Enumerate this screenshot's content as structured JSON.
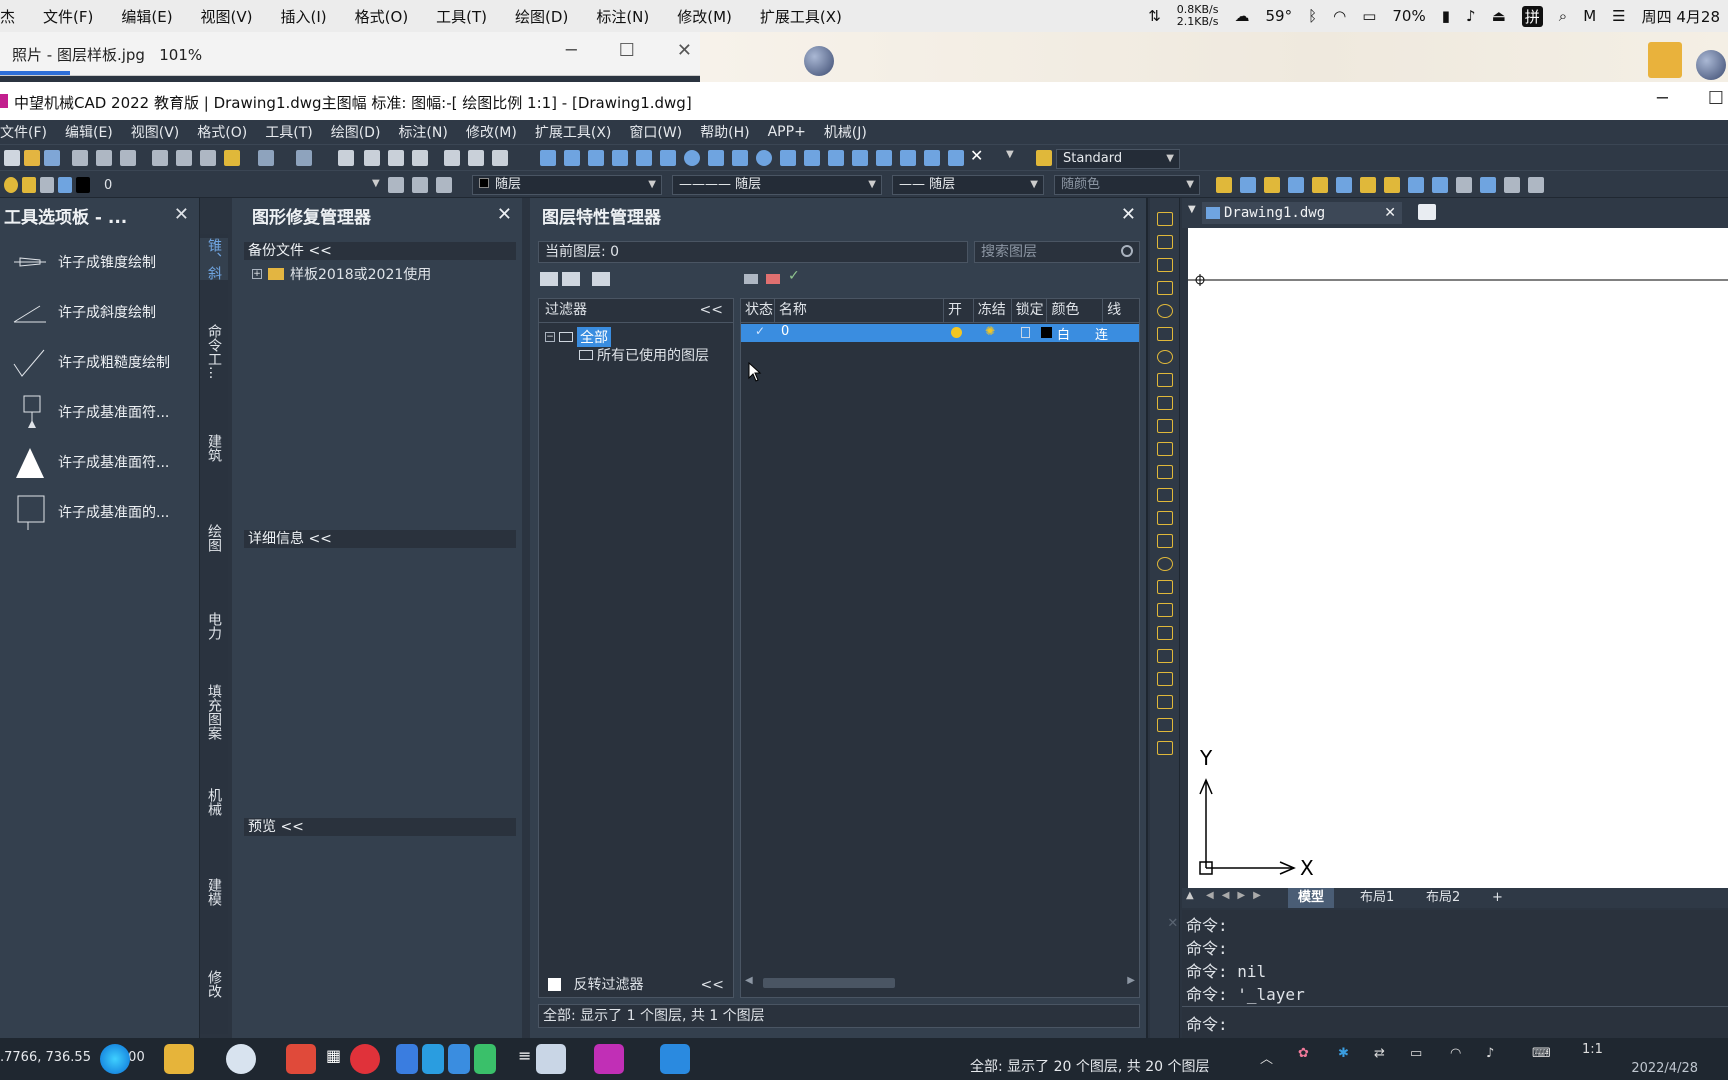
{
  "mac_menubar": {
    "app": "杰",
    "items": [
      "文件(F)",
      "编辑(E)",
      "视图(V)",
      "插入(I)",
      "格式(O)",
      "工具(T)",
      "绘图(D)",
      "标注(N)",
      "修改(M)",
      "扩展工具(X)"
    ],
    "net_up": "0.8KB/s",
    "net_down": "2.1KB/s",
    "temperature": "59°",
    "battery": "70%",
    "datetime": "周四 4月28"
  },
  "photo_viewer": {
    "title": "照片 - 图层样板.jpg",
    "zoom": "101%",
    "progress": 0.1
  },
  "cad_window": {
    "title": "中望机械CAD 2022 教育版 | Drawing1.dwg主图幅 标准: 图幅:-[ 绘图比例 1:1] - [Drawing1.dwg]"
  },
  "cad_menu": [
    "文件(F)",
    "编辑(E)",
    "视图(V)",
    "格式(O)",
    "工具(T)",
    "绘图(D)",
    "标注(N)",
    "修改(M)",
    "扩展工具(X)",
    "窗口(W)",
    "帮助(H)",
    "APP+",
    "机械(J)"
  ],
  "toolbar": {
    "text_style": "Standard",
    "layer_value": "0",
    "color_value": "随层",
    "linetype_value": "随层",
    "lineweight_value": "随层",
    "plotstyle_value": "随颜色"
  },
  "tool_palette": {
    "title": "工具选项板 - ...",
    "items": [
      "许子成锥度绘制",
      "许子成斜度绘制",
      "许子成粗糙度绘制",
      "许子成基准面符...",
      "许子成基准面符...",
      "许子成基准面的..."
    ],
    "tabs": [
      "锥、斜",
      "命令工...",
      "建筑",
      "绘图",
      "电力",
      "填充图案",
      "机械",
      "建模",
      "修改"
    ]
  },
  "repair_manager": {
    "title": "图形修复管理器",
    "backup_label": "备份文件 <<",
    "backup_item": "样板2018或2021使用",
    "details_label": "详细信息 <<",
    "preview_label": "预览 <<"
  },
  "layer_manager": {
    "title": "图层特性管理器",
    "current_layer": "当前图层: 0",
    "search_placeholder": "搜索图层",
    "filter_header": "过滤器",
    "filter_collapse": "<<",
    "filter_all": "全部",
    "filter_used": "所有已使用的图层",
    "invert_filter": "反转过滤器",
    "columns": [
      "状态",
      "名称",
      "开",
      "冻结",
      "锁定",
      "颜色",
      "线"
    ],
    "row": {
      "name": "0",
      "color": "白",
      "linetype_abbr": "连"
    },
    "status_text": "全部:   显示了 1 个图层, 共 1 个图层"
  },
  "drawing": {
    "tab_name": "Drawing1.dwg",
    "axis_x": "X",
    "axis_y": "Y",
    "layout_tabs": [
      "模型",
      "布局1",
      "布局2",
      "+"
    ]
  },
  "command_lines": [
    "命令:",
    "命令:",
    "命令: nil",
    "命令: '_layer",
    "命令:"
  ],
  "taskbar": {
    "coords": ".7766, 736.55",
    "coords_z": "0.00",
    "status": "全部:   显示了 20 个图层, 共 20 个图层",
    "scale": "1:1",
    "date": "2022/4/28"
  },
  "colors": {
    "accent": "#3a8de0",
    "panel_bg": "#34404e",
    "dark_bg": "#2a323d",
    "icon_yellow": "#e0b83a"
  }
}
